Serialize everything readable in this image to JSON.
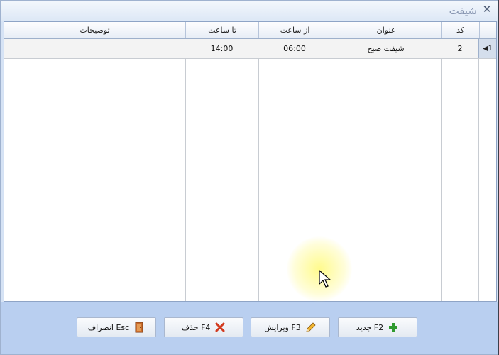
{
  "window": {
    "title": "شیفت"
  },
  "grid": {
    "columns": {
      "code": "کد",
      "title": "عنوان",
      "from_time": "از ساعت",
      "to_time": "تا ساعت",
      "notes": "توضیحات"
    },
    "rows": [
      {
        "indicator": "1",
        "code": "2",
        "title": "شیفت صبح",
        "from_time": "06:00",
        "to_time": "14:00",
        "notes": ""
      }
    ]
  },
  "footer": {
    "new_label": "جدید F2",
    "edit_label": "ویرایش F3",
    "delete_label": "حذف F4",
    "cancel_label": "انصراف Esc"
  },
  "icons": {
    "close": "close-icon",
    "new": "plus-icon",
    "edit": "pencil-icon",
    "delete": "x-icon",
    "cancel": "exit-door-icon"
  },
  "colors": {
    "title_text": "#8a98b3",
    "footer_bg": "#b9cff0",
    "plus": "#2f9a2f",
    "delete_x": "#d23a1f"
  }
}
